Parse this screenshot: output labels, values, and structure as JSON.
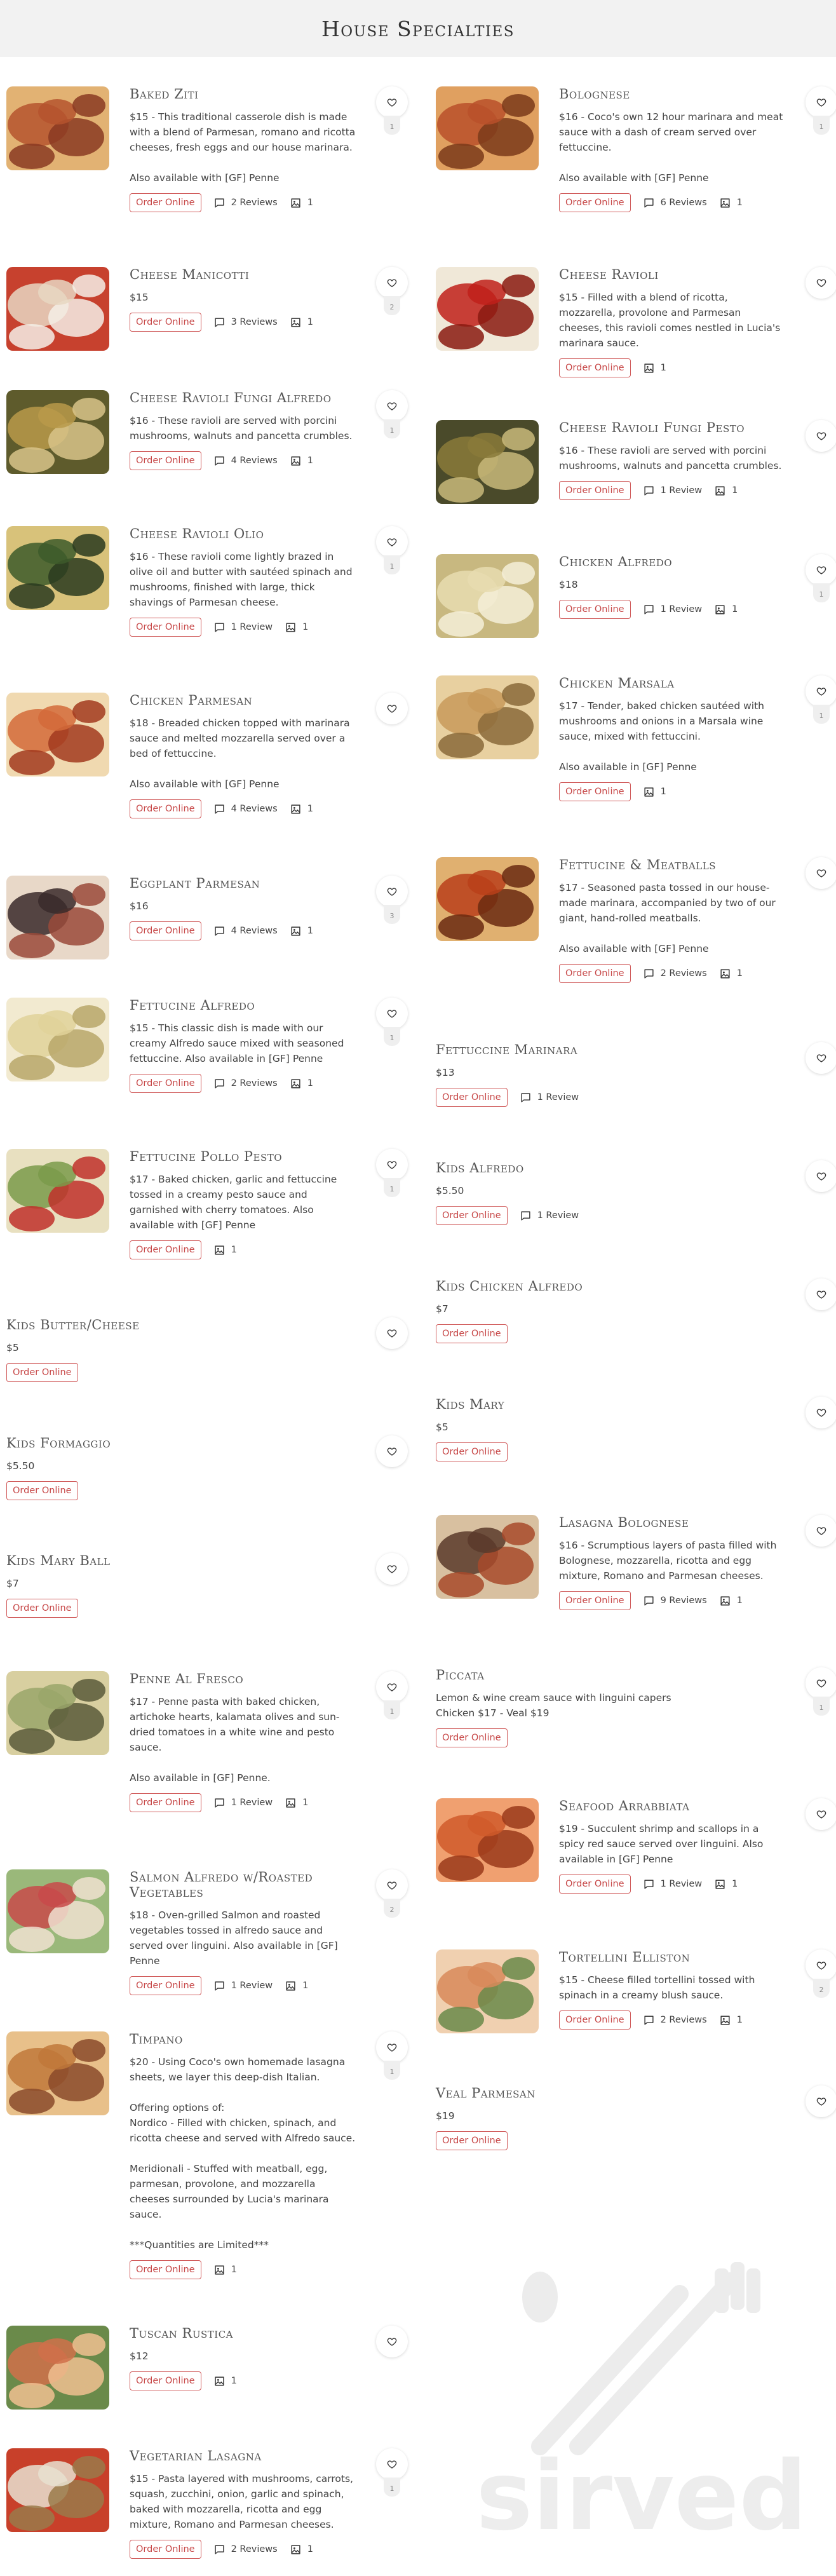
{
  "page": {
    "title": "House Specialties"
  },
  "labels": {
    "order": "Order Online",
    "brand": "sirved"
  },
  "colors": {
    "accent": "#c74848",
    "header_bg": "#f2f2f2"
  },
  "left_items": [
    {
      "name": "Baked Ziti",
      "desc": "$15 - This traditional casserole dish is made with a blend of Parmesan, romano and ricotta cheeses, fresh eggs and our house marinara.\n\nAlso available with [GF] Penne",
      "reviews": "2 Reviews",
      "photos": "1",
      "likes": "1",
      "image": "baked-ziti-photo"
    },
    {
      "name": "Cheese Manicotti",
      "desc": "$15",
      "reviews": "3 Reviews",
      "photos": "1",
      "likes": "2",
      "image": "cheese-manicotti-photo"
    },
    {
      "name": "Cheese Ravioli Fungi Alfredo",
      "desc": "$16 - These ravioli are served with porcini mushrooms, walnuts and pancetta crumbles.",
      "reviews": "4 Reviews",
      "photos": "1",
      "likes": "1",
      "image": "cheese-ravioli-fungi-alfredo-photo"
    },
    {
      "name": "Cheese Ravioli Olio",
      "desc": "$16 - These ravioli come lightly brazed in olive oil and butter with sautéed spinach and mushrooms, finished with large, thick shavings of Parmesan cheese.",
      "reviews": "1 Review",
      "photos": "1",
      "likes": "1",
      "image": "cheese-ravioli-olio-photo"
    },
    {
      "name": "Chicken Parmesan",
      "desc": "$18 - Breaded chicken topped with marinara sauce and melted mozzarella served over a bed of fettuccine.\n\nAlso available with [GF] Penne",
      "reviews": "4 Reviews",
      "photos": "1",
      "likes": "",
      "image": "chicken-parmesan-photo"
    },
    {
      "name": "Eggplant Parmesan",
      "desc": "$16",
      "reviews": "4 Reviews",
      "photos": "1",
      "likes": "3",
      "image": "eggplant-parmesan-photo"
    },
    {
      "name": "Fettucine Alfredo",
      "desc": "$15 - This classic dish is made with our creamy Alfredo sauce mixed with seasoned fettuccine. Also available in [GF] Penne",
      "reviews": "2 Reviews",
      "photos": "1",
      "likes": "1",
      "image": "fettucine-alfredo-photo"
    },
    {
      "name": "Fettucine Pollo Pesto",
      "desc": "$17 - Baked chicken, garlic and fettuccine tossed in a creamy pesto sauce and garnished with cherry tomatoes. Also available with [GF] Penne",
      "reviews": "",
      "photos": "1",
      "likes": "1",
      "image": "fettucine-pollo-pesto-photo"
    },
    {
      "name": "Kids Butter/Cheese",
      "desc": "$5",
      "reviews": "",
      "photos": "",
      "likes": "",
      "image": ""
    },
    {
      "name": "Kids Formaggio",
      "desc": "$5.50",
      "reviews": "",
      "photos": "",
      "likes": "",
      "image": ""
    },
    {
      "name": "Kids Mary Ball",
      "desc": "$7",
      "reviews": "",
      "photos": "",
      "likes": "",
      "image": ""
    },
    {
      "name": "Penne Al Fresco",
      "desc": "$17 - Penne pasta with baked chicken, artichoke hearts, kalamata olives and sun-dried tomatoes in a white wine and pesto sauce.\n\nAlso available in [GF] Penne.",
      "reviews": "1 Review",
      "photos": "1",
      "likes": "1",
      "image": "penne-al-fresco-photo"
    },
    {
      "name": "Salmon Alfredo w/Roasted Vegetables",
      "desc": "$18 - Oven-grilled Salmon and roasted vegetables tossed in alfredo sauce and served over linguini. Also available in [GF] Penne",
      "reviews": "1 Review",
      "photos": "1",
      "likes": "2",
      "image": "salmon-alfredo-photo"
    },
    {
      "name": "Timpano",
      "desc": "$20 - Using Coco's own homemade lasagna sheets, we layer this deep-dish Italian.\n\nOffering options of:\nNordico - Filled with chicken, spinach, and ricotta cheese and served with Alfredo sauce.\n\nMeridionali - Stuffed with meatball, egg, parmesan, provolone, and mozzarella cheeses surrounded by Lucia's marinara sauce.\n\n***Quantities are Limited***",
      "reviews": "",
      "photos": "1",
      "likes": "1",
      "image": "timpano-photo"
    },
    {
      "name": "Tuscan Rustica",
      "desc": "$12",
      "reviews": "",
      "photos": "1",
      "likes": "",
      "image": "tuscan-rustica-photo"
    },
    {
      "name": "Vegetarian Lasagna",
      "desc": "$15 - Pasta layered with mushrooms, carrots, squash, zucchini, onion, garlic and spinach, baked with mozzarella, ricotta and egg mixture, Romano and Parmesan cheeses.",
      "reviews": "2 Reviews",
      "photos": "1",
      "likes": "1",
      "image": "vegetarian-lasagna-photo"
    }
  ],
  "right_items": [
    {
      "name": "Bolognese",
      "desc": "$16 - Coco's own 12 hour marinara and meat sauce with a dash of cream served over fettuccine.\n\nAlso available with [GF] Penne",
      "reviews": "6 Reviews",
      "photos": "1",
      "likes": "1",
      "image": "bolognese-photo"
    },
    {
      "name": "Cheese Ravioli",
      "desc": "$15 - Filled with a blend of ricotta, mozzarella, provolone and Parmesan cheeses, this ravioli comes nestled in Lucia's marinara sauce.",
      "reviews": "",
      "photos": "1",
      "likes": "",
      "image": "cheese-ravioli-photo"
    },
    {
      "name": "Cheese Ravioli Fungi Pesto",
      "desc": "$16 - These ravioli are served with porcini mushrooms, walnuts and pancetta crumbles.",
      "reviews": "1 Review",
      "photos": "1",
      "likes": "",
      "image": "cheese-ravioli-fungi-pesto-photo"
    },
    {
      "name": "Chicken Alfredo",
      "desc": "$18",
      "reviews": "1 Review",
      "photos": "1",
      "likes": "1",
      "image": "chicken-alfredo-photo"
    },
    {
      "name": "Chicken Marsala",
      "desc": "$17 - Tender, baked chicken sautéed with mushrooms and onions in a Marsala wine sauce, mixed with fettuccini.\n\nAlso available in [GF] Penne",
      "reviews": "",
      "photos": "1",
      "likes": "1",
      "image": "chicken-marsala-photo"
    },
    {
      "name": "Fettucine & Meatballs",
      "desc": "$17 - Seasoned pasta tossed in our house-made marinara, accompanied by two of our giant, hand-rolled meatballs.\n\nAlso available with [GF] Penne",
      "reviews": "2 Reviews",
      "photos": "1",
      "likes": "",
      "image": "fettucine-meatballs-photo"
    },
    {
      "name": "Fettuccine Marinara",
      "desc": "$13",
      "reviews": "1 Review",
      "photos": "",
      "likes": "",
      "image": ""
    },
    {
      "name": "Kids Alfredo",
      "desc": "$5.50",
      "reviews": "1 Review",
      "photos": "",
      "likes": "",
      "image": ""
    },
    {
      "name": "Kids Chicken Alfredo",
      "desc": "$7",
      "reviews": "",
      "photos": "",
      "likes": "",
      "image": ""
    },
    {
      "name": "Kids Mary",
      "desc": "$5",
      "reviews": "",
      "photos": "",
      "likes": "",
      "image": ""
    },
    {
      "name": "Lasagna Bolognese",
      "desc": "$16 - Scrumptious layers of pasta filled with Bolognese, mozzarella, ricotta and egg mixture, Romano and Parmesan cheeses.",
      "reviews": "9 Reviews",
      "photos": "1",
      "likes": "",
      "image": "lasagna-bolognese-photo"
    },
    {
      "name": "Piccata",
      "desc": "Lemon & wine cream sauce with linguini capers\nChicken $17 - Veal $19",
      "reviews": "",
      "photos": "",
      "likes": "1",
      "image": ""
    },
    {
      "name": "Seafood Arrabbiata",
      "desc": "$19 - Succulent shrimp and scallops in a spicy red sauce served over linguini. Also available in [GF] Penne",
      "reviews": "1 Review",
      "photos": "1",
      "likes": "",
      "image": "seafood-arrabbiata-photo"
    },
    {
      "name": "Tortellini Elliston",
      "desc": "$15 - Cheese filled tortellini tossed with spinach in a creamy blush sauce.",
      "reviews": "2 Reviews",
      "photos": "1",
      "likes": "2",
      "image": "tortellini-elliston-photo"
    },
    {
      "name": "Veal Parmesan",
      "desc": "$19",
      "reviews": "",
      "photos": "",
      "likes": "",
      "image": ""
    }
  ]
}
